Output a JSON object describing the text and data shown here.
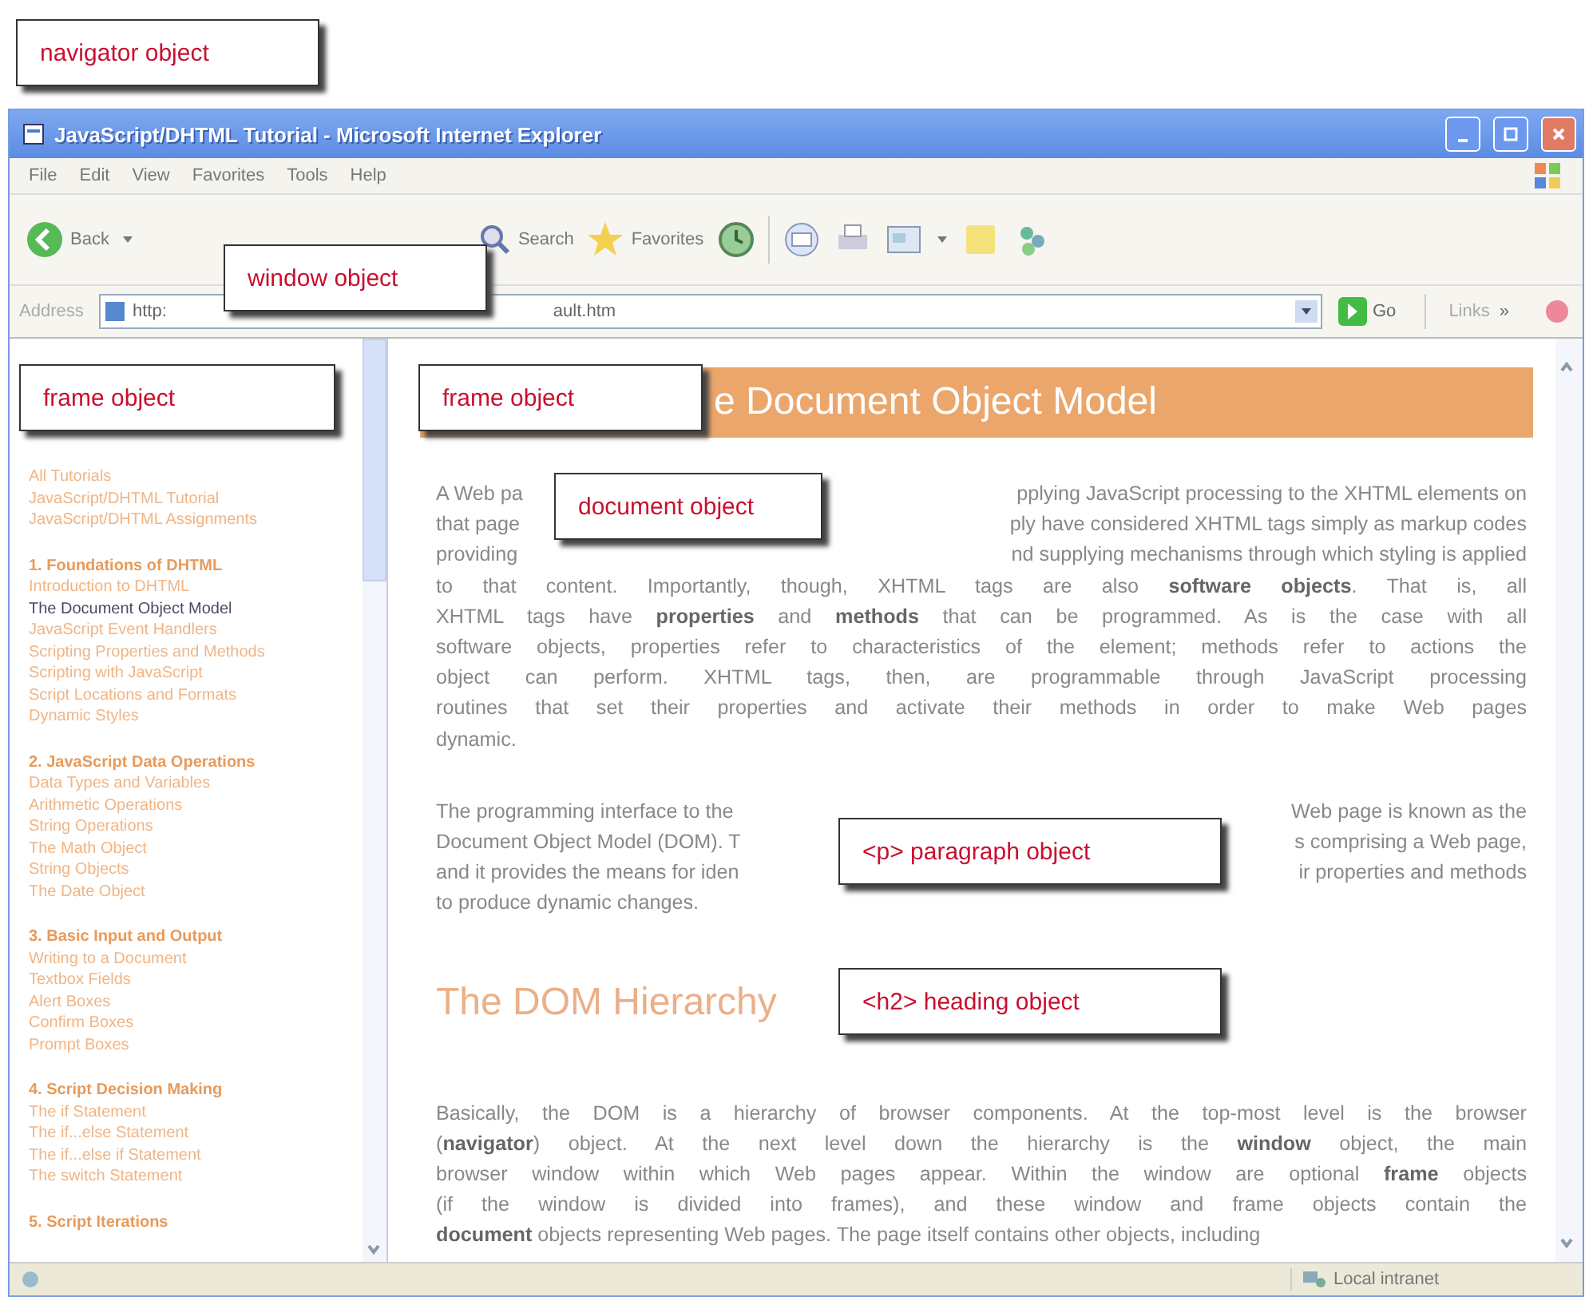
{
  "window": {
    "title": "JavaScript/DHTML Tutorial - Microsoft Internet Explorer"
  },
  "menu": [
    "File",
    "Edit",
    "View",
    "Favorites",
    "Tools",
    "Help"
  ],
  "toolbar": {
    "back": "Back",
    "search": "Search",
    "favorites": "Favorites"
  },
  "address_bar": {
    "label": "Address",
    "url_start": "http:",
    "url_end": "ault.htm",
    "go": "Go",
    "links": "Links",
    "more": "»"
  },
  "sidebar": {
    "groups": [
      {
        "items": [
          {
            "label": "All Tutorials",
            "selected": false
          },
          {
            "label": "JavaScript/DHTML Tutorial",
            "selected": false
          },
          {
            "label": "JavaScript/DHTML Assignments",
            "selected": false
          }
        ]
      },
      {
        "heading": "1. Foundations of DHTML",
        "items": [
          {
            "label": "Introduction to DHTML",
            "selected": false
          },
          {
            "label": "The Document Object Model",
            "selected": true
          },
          {
            "label": "JavaScript Event Handlers",
            "selected": false
          },
          {
            "label": "Scripting Properties and Methods",
            "selected": false
          },
          {
            "label": "Scripting with JavaScript",
            "selected": false
          },
          {
            "label": "Script Locations and Formats",
            "selected": false
          },
          {
            "label": "Dynamic Styles",
            "selected": false
          }
        ]
      },
      {
        "heading": "2. JavaScript Data Operations",
        "items": [
          {
            "label": "Data Types and Variables",
            "selected": false
          },
          {
            "label": "Arithmetic Operations",
            "selected": false
          },
          {
            "label": "String Operations",
            "selected": false
          },
          {
            "label": "The Math Object",
            "selected": false
          },
          {
            "label": "String Objects",
            "selected": false
          },
          {
            "label": "The Date Object",
            "selected": false
          }
        ]
      },
      {
        "heading": "3. Basic Input and Output",
        "items": [
          {
            "label": "Writing to a Document",
            "selected": false
          },
          {
            "label": "Textbox Fields",
            "selected": false
          },
          {
            "label": "Alert Boxes",
            "selected": false
          },
          {
            "label": "Confirm Boxes",
            "selected": false
          },
          {
            "label": "Prompt Boxes",
            "selected": false
          }
        ]
      },
      {
        "heading": "4. Script Decision Making",
        "items": [
          {
            "label": "The if Statement",
            "selected": false
          },
          {
            "label": "The if...else Statement",
            "selected": false
          },
          {
            "label": "The if...else if Statement",
            "selected": false
          },
          {
            "label": "The switch Statement",
            "selected": false
          }
        ]
      },
      {
        "heading": "5. Script Iterations"
      }
    ]
  },
  "main": {
    "heading": "e Document Object Model",
    "blocks": [
      {
        "kind": "paragraph",
        "lines": [
          {
            "left": "A Web pa",
            "right": "pplying JavaScript processing to the XHTML elements on"
          },
          {
            "left": "that page",
            "right": "ply have considered XHTML tags simply as markup codes"
          },
          {
            "left": "providing",
            "right": "nd supplying mechanisms through which styling is applied"
          },
          {
            "text": "to that content. Importantly, though, XHTML tags are also **software objects**. That is, all"
          },
          {
            "text": "XHTML tags have **properties** and **methods** that can be programmed. As is the case with all"
          },
          {
            "text": "software objects, properties refer to characteristics of the element; methods refer to actions the"
          },
          {
            "text": "object can perform. XHTML tags, then, are programmable through JavaScript processing"
          },
          {
            "text": "routines that set their properties and activate their methods in order to make Web pages"
          },
          {
            "text": "dynamic."
          }
        ]
      },
      {
        "kind": "paragraph",
        "lines": [
          {
            "left": "The programming interface to the",
            "right": "Web page is known as the"
          },
          {
            "left": "Document Object Model (DOM). T",
            "right": "s comprising a Web page,"
          },
          {
            "left": "and it provides the means for iden",
            "right": "ir properties and methods"
          },
          {
            "text": "to produce dynamic changes."
          }
        ]
      },
      {
        "kind": "subheading",
        "text": "The DOM Hierarchy"
      },
      {
        "kind": "paragraph",
        "lines": [
          {
            "text": "Basically, the DOM is a hierarchy of browser components. At the top-most level is the browser"
          },
          {
            "text": "(**navigator**) object. At the next level down the hierarchy is the **window** object, the main"
          },
          {
            "text": "browser window within which Web pages appear. Within the window are optional **frame** objects"
          },
          {
            "text": "(if the window is divided into frames), and these window and frame objects contain the"
          },
          {
            "text": "**document** objects representing Web pages. The page itself contains other objects, including"
          }
        ]
      }
    ]
  },
  "status_bar": {
    "zone": "Local intranet"
  },
  "callouts": [
    {
      "label": "navigator object"
    },
    {
      "label": "window object"
    },
    {
      "label": "frame object"
    },
    {
      "label": "frame object"
    },
    {
      "label": "document object"
    },
    {
      "label": "<p> paragraph object"
    },
    {
      "label": "<h2> heading object"
    }
  ]
}
